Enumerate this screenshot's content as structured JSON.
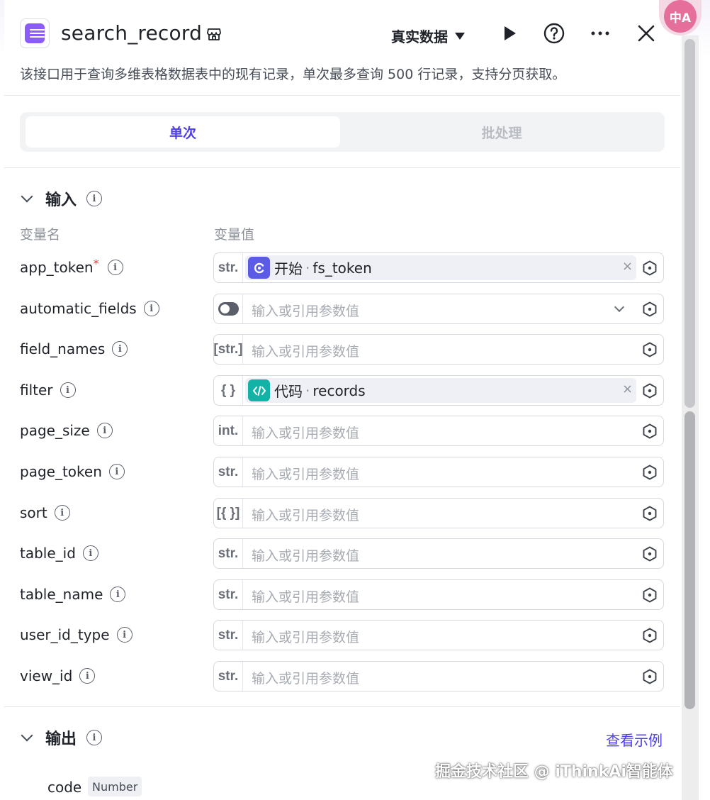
{
  "header": {
    "title": "search_record",
    "mode_label": "真实数据",
    "description": "该接口用于查询多维表格数据表中的现有记录，单次最多查询 500 行记录，支持分页获取。"
  },
  "tabs": [
    {
      "label": "单次",
      "active": true
    },
    {
      "label": "批处理",
      "active": false
    }
  ],
  "input_section": {
    "title": "输入",
    "col_name": "变量名",
    "col_value": "变量值",
    "placeholder": "输入或引用参数值",
    "params": [
      {
        "name": "app_token",
        "required": true,
        "type": "str.",
        "ref_source": "开始",
        "ref_field": "fs_token",
        "ref_icon": "start-icon"
      },
      {
        "name": "automatic_fields",
        "type": "toggle",
        "select": true
      },
      {
        "name": "field_names",
        "type": "[str.]"
      },
      {
        "name": "filter",
        "type": "{ }",
        "ref_source": "代码",
        "ref_field": "records",
        "ref_icon": "code-icon"
      },
      {
        "name": "page_size",
        "type": "int."
      },
      {
        "name": "page_token",
        "type": "str."
      },
      {
        "name": "sort",
        "type": "[{ }]"
      },
      {
        "name": "table_id",
        "type": "str."
      },
      {
        "name": "table_name",
        "type": "str."
      },
      {
        "name": "user_id_type",
        "type": "str."
      },
      {
        "name": "view_id",
        "type": "str."
      }
    ]
  },
  "output_section": {
    "title": "输出",
    "example_link": "查看示例",
    "fields": [
      {
        "name": "code",
        "type": "Number"
      }
    ]
  },
  "watermark": "掘金技术社区 @ iThinkAi智能体",
  "lang_badge": "中A",
  "colors": {
    "accent": "#4e40e5",
    "app_icon": "#8b5cf6",
    "start_ref": "#5b5be6",
    "code_ref": "#12b3a6"
  }
}
